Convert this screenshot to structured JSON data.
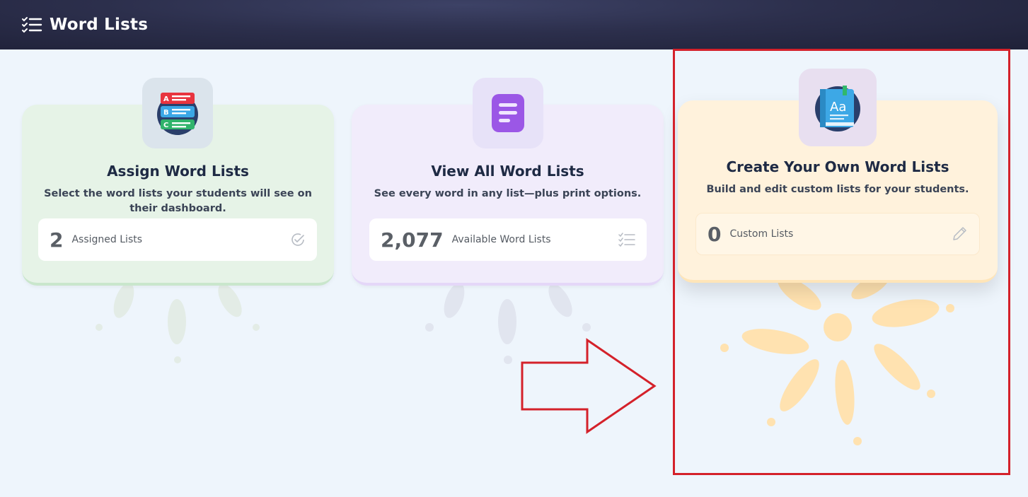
{
  "header": {
    "title": "Word Lists",
    "icon": "checklist-icon"
  },
  "cards": [
    {
      "title": "Assign Word Lists",
      "description": "Select the word lists your students will see on their dashboard.",
      "stat_value": "2",
      "stat_label": "Assigned Lists",
      "icon": "abc-list-icon",
      "stat_icon": "check-circle-icon",
      "color": "#e6f3e7"
    },
    {
      "title": "View All Word Lists",
      "description": "See every word in any list—plus print options.",
      "stat_value": "2,077",
      "stat_label": "Available Word Lists",
      "icon": "document-lines-icon",
      "stat_icon": "list-icon",
      "color": "#f1ecfb"
    },
    {
      "title": "Create Your Own Word Lists",
      "description": "Build and edit custom lists for your students.",
      "stat_value": "0",
      "stat_label": "Custom Lists",
      "icon": "book-aa-icon",
      "stat_icon": "pencil-icon",
      "color": "#fff2dc"
    }
  ],
  "annotations": {
    "highlight_color": "#d4212a",
    "arrow_color": "#d4212a"
  }
}
